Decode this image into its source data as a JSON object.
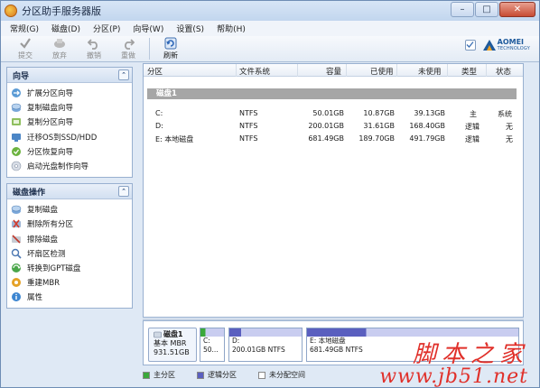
{
  "window": {
    "title": "分区助手服务器版",
    "minimize_glyph": "–",
    "maximize_glyph": "□",
    "close_glyph": "✕"
  },
  "menu": [
    "常规(G)",
    "磁盘(D)",
    "分区(P)",
    "向导(W)",
    "设置(S)",
    "帮助(H)"
  ],
  "toolbar": {
    "items": [
      {
        "label": "提交",
        "icon": "commit-check-icon",
        "enabled": false
      },
      {
        "label": "放弃",
        "icon": "discard-icon",
        "enabled": false
      },
      {
        "label": "撤销",
        "icon": "undo-icon",
        "enabled": false
      },
      {
        "label": "重做",
        "icon": "redo-icon",
        "enabled": false
      },
      {
        "label": "刷新",
        "icon": "refresh-icon",
        "enabled": true
      }
    ],
    "brand_name": "AOMEI",
    "brand_sub": "TECHNOLOGY"
  },
  "wizard_panel": {
    "title": "向导",
    "collapse_glyph": "⌃",
    "items": [
      {
        "label": "扩展分区向导",
        "icon": "extend-wizard-icon"
      },
      {
        "label": "复制磁盘向导",
        "icon": "copy-disk-icon"
      },
      {
        "label": "复制分区向导",
        "icon": "copy-partition-icon"
      },
      {
        "label": "迁移OS到SSD/HDD",
        "icon": "migrate-os-icon"
      },
      {
        "label": "分区恢复向导",
        "icon": "partition-recovery-icon"
      },
      {
        "label": "启动光盘制作向导",
        "icon": "bootable-cd-icon"
      }
    ]
  },
  "disk_ops_panel": {
    "title": "磁盘操作",
    "collapse_glyph": "⌃",
    "items": [
      {
        "label": "复制磁盘",
        "icon": "copy-disk-icon"
      },
      {
        "label": "删除所有分区",
        "icon": "delete-all-icon"
      },
      {
        "label": "擦除磁盘",
        "icon": "wipe-disk-icon"
      },
      {
        "label": "坏扇区检测",
        "icon": "bad-sector-icon"
      },
      {
        "label": "转换到GPT磁盘",
        "icon": "convert-gpt-icon"
      },
      {
        "label": "重建MBR",
        "icon": "rebuild-mbr-icon"
      },
      {
        "label": "属性",
        "icon": "properties-icon"
      }
    ]
  },
  "table": {
    "columns": [
      "分区",
      "文件系统",
      "容量",
      "已使用",
      "未使用",
      "类型",
      "状态"
    ],
    "disk_label": "磁盘1",
    "rows": [
      {
        "partition": "C:",
        "fs": "NTFS",
        "capacity": "50.01GB",
        "used": "10.87GB",
        "unused": "39.13GB",
        "type": "主",
        "status": "系统"
      },
      {
        "partition": "D:",
        "fs": "NTFS",
        "capacity": "200.01GB",
        "used": "31.61GB",
        "unused": "168.40GB",
        "type": "逻辑",
        "status": "无"
      },
      {
        "partition": "E: 本地磁盘",
        "fs": "NTFS",
        "capacity": "681.49GB",
        "used": "189.70GB",
        "unused": "491.79GB",
        "type": "逻辑",
        "status": "无"
      }
    ]
  },
  "disk_map": {
    "disk": {
      "name": "磁盘1",
      "type": "基本 MBR",
      "size": "931.51GB"
    },
    "partitions": [
      {
        "name": "C:",
        "info": "50...",
        "color": "#3aa83a",
        "used_fraction": 0.22
      },
      {
        "name": "D:",
        "info": "200.01GB NTFS",
        "color": "#5a5fbf",
        "used_fraction": 0.16
      },
      {
        "name": "E: 本地磁盘",
        "info": "681.49GB NTFS",
        "color": "#5a5fbf",
        "used_fraction": 0.28
      }
    ]
  },
  "legend": [
    {
      "label": "主分区",
      "color": "#3aa83a"
    },
    {
      "label": "逻辑分区",
      "color": "#5a5fbf"
    },
    {
      "label": "未分配空间",
      "color": "#ffffff"
    }
  ],
  "watermark": {
    "line1": "脚本之家",
    "line2": "www.jb51.net"
  }
}
